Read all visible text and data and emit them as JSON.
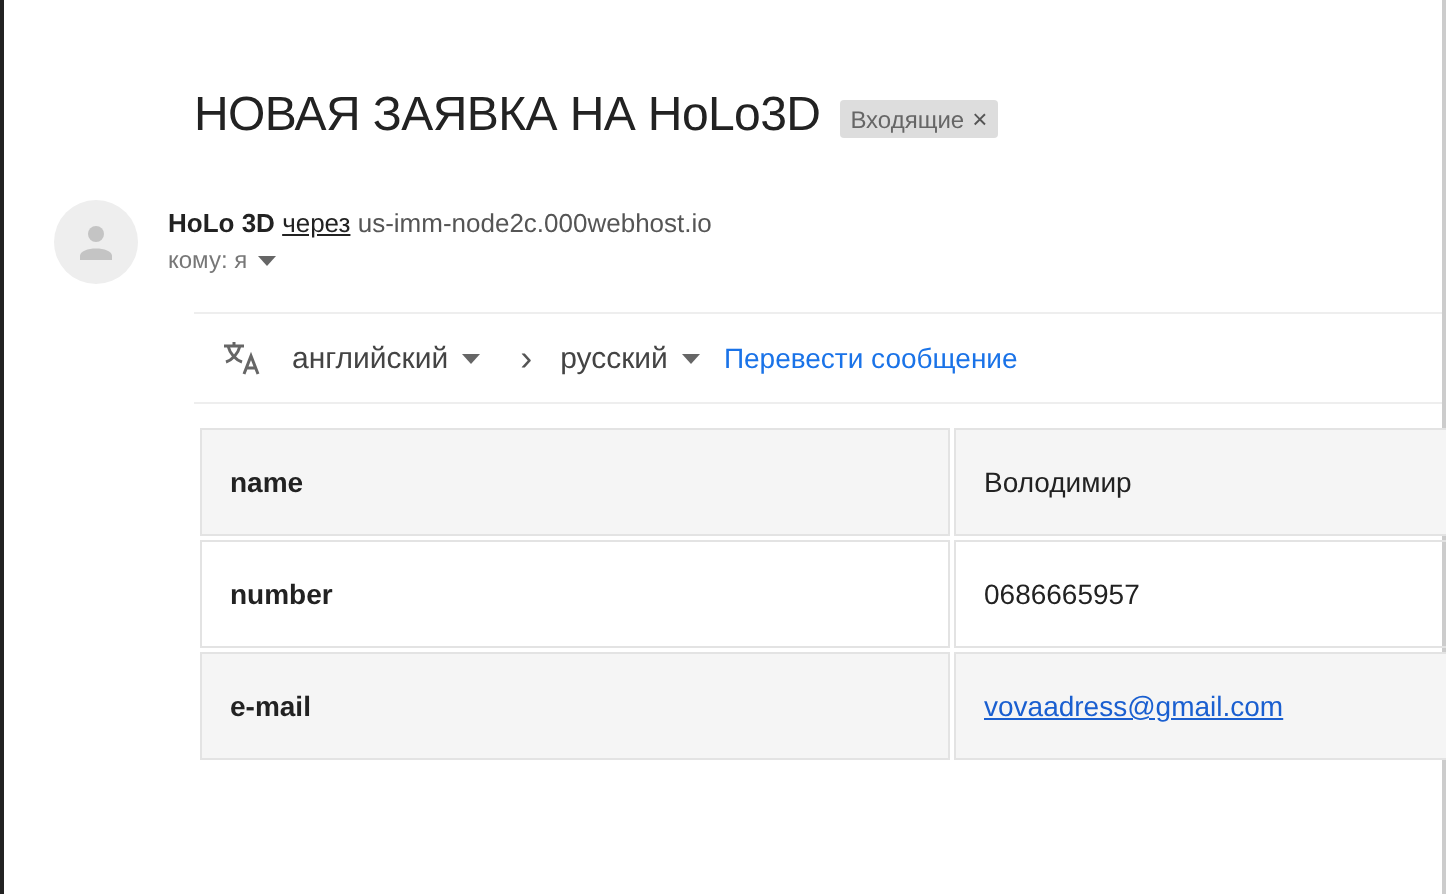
{
  "subject": "НОВАЯ ЗАЯВКА НА HoLo3D",
  "label": {
    "text": "Входящие",
    "close": "×"
  },
  "sender": {
    "name": "HoLo 3D",
    "via": "через",
    "host": "us-imm-node2c.000webhost.io",
    "to": "кому: я"
  },
  "translate": {
    "from": "английский",
    "to": "русский",
    "arrow": "›",
    "action": "Перевести сообщение"
  },
  "table": {
    "rows": [
      {
        "field": "name",
        "value": "Володимир",
        "kind": "text"
      },
      {
        "field": "number",
        "value": "0686665957",
        "kind": "text"
      },
      {
        "field": "e-mail",
        "value": "vovaadress@gmail.com",
        "kind": "link"
      }
    ]
  }
}
